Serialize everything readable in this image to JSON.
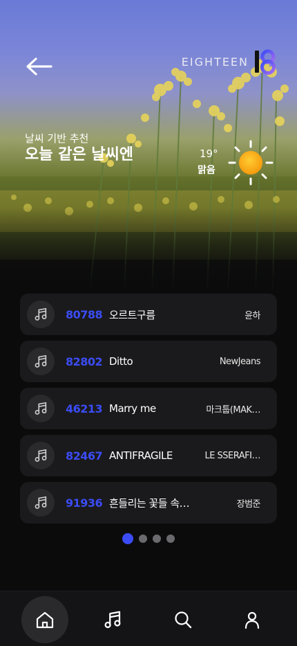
{
  "header": {
    "brand_text": "EIGHTEEN",
    "brand_logo_text": "18",
    "back_icon": "arrow-left-icon"
  },
  "weather": {
    "subtitle": "날씨 기반 추천",
    "title": "오늘 같은 날씨엔",
    "temperature": "19°",
    "condition": "맑음",
    "icon": "sun-icon"
  },
  "songs": [
    {
      "number": "80788",
      "title": "오르트구름",
      "artist": "윤하"
    },
    {
      "number": "82802",
      "title": "Ditto",
      "artist": "NewJeans"
    },
    {
      "number": "46213",
      "title": "Marry me",
      "artist": "마크툽(MAK…"
    },
    {
      "number": "82467",
      "title": "ANTIFRAGILE",
      "artist": "LE SSERAFI…"
    },
    {
      "number": "91936",
      "title": "흔들리는 꽃들 속…",
      "artist": "장범준"
    }
  ],
  "pagination": {
    "pages": 4,
    "current": 1
  },
  "nav": {
    "items": [
      {
        "icon": "home-icon",
        "active": true
      },
      {
        "icon": "music-note-icon",
        "active": false
      },
      {
        "icon": "search-icon",
        "active": false
      },
      {
        "icon": "profile-icon",
        "active": false
      }
    ]
  },
  "colors": {
    "accent": "#3b4cf5",
    "background": "#0b0b0c",
    "card": "#1a1a1c"
  }
}
